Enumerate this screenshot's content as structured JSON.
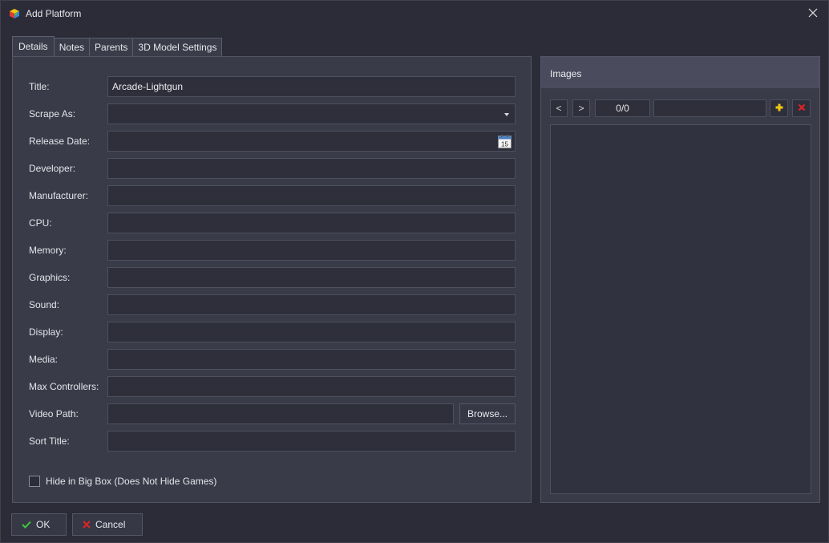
{
  "window": {
    "title": "Add Platform"
  },
  "icons": {
    "app": "launchbox-cube-icon",
    "close": "close-icon",
    "dropdown": "chevron-down-icon",
    "calendar": "calendar-icon",
    "add": "add-icon",
    "remove": "remove-icon",
    "ok": "checkmark-icon",
    "cancel": "x-icon"
  },
  "tabs": [
    {
      "label": "Details",
      "active": true
    },
    {
      "label": "Notes",
      "active": false
    },
    {
      "label": "Parents",
      "active": false
    },
    {
      "label": "3D Model Settings",
      "active": false
    }
  ],
  "form": {
    "title": {
      "label": "Title:",
      "value": "Arcade-Lightgun"
    },
    "scrape_as": {
      "label": "Scrape As:",
      "value": ""
    },
    "release_date": {
      "label": "Release Date:",
      "value": "",
      "calendar_day": "15"
    },
    "developer": {
      "label": "Developer:",
      "value": ""
    },
    "manufacturer": {
      "label": "Manufacturer:",
      "value": ""
    },
    "cpu": {
      "label": "CPU:",
      "value": ""
    },
    "memory": {
      "label": "Memory:",
      "value": ""
    },
    "graphics": {
      "label": "Graphics:",
      "value": ""
    },
    "sound": {
      "label": "Sound:",
      "value": ""
    },
    "display": {
      "label": "Display:",
      "value": ""
    },
    "media": {
      "label": "Media:",
      "value": ""
    },
    "max_controllers": {
      "label": "Max Controllers:",
      "value": ""
    },
    "video_path": {
      "label": "Video Path:",
      "value": "",
      "browse_label": "Browse..."
    },
    "sort_title": {
      "label": "Sort Title:",
      "value": ""
    },
    "hide_in_bigbox": {
      "label": "Hide in Big Box (Does Not Hide Games)",
      "checked": false
    }
  },
  "images": {
    "header": "Images",
    "prev_label": "<",
    "next_label": ">",
    "counter": "0/0",
    "type_value": ""
  },
  "buttons": {
    "ok_label": "OK",
    "cancel_label": "Cancel"
  },
  "colors": {
    "background": "#2b2c37",
    "panel": "#393b48",
    "input": "#2e2f3b",
    "ok_check": "#3cc83c",
    "cancel_x": "#e02424",
    "add_icon": "#f2c811",
    "remove_icon": "#e02424"
  }
}
